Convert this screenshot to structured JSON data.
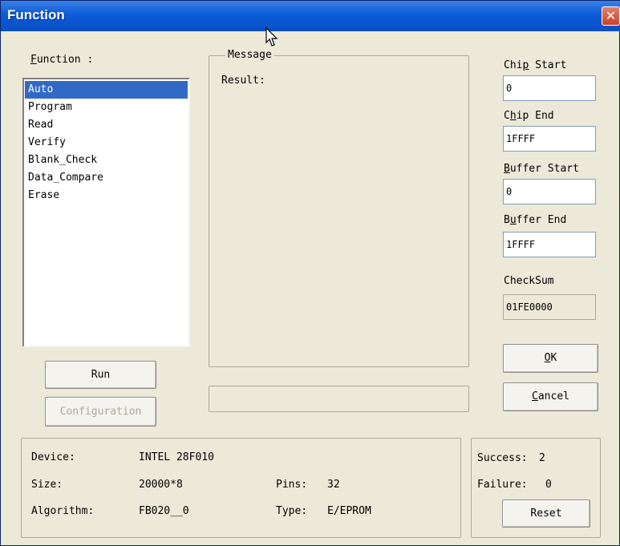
{
  "window": {
    "title": "Function",
    "close_glyph": "✕"
  },
  "function_list": {
    "label": "Function :",
    "items": [
      "Auto",
      "Program",
      "Read",
      "Verify",
      "Blank_Check",
      "Data_Compare",
      "Erase"
    ],
    "selected": "Auto"
  },
  "message": {
    "legend": "Message",
    "result_label": "Result:"
  },
  "fields": {
    "chip_start": {
      "label": "Chip Start",
      "value": "0"
    },
    "chip_end": {
      "label": "Chip End",
      "value": "1FFFF"
    },
    "buffer_start": {
      "label": "Buffer Start",
      "value": "0"
    },
    "buffer_end": {
      "label": "Buffer End",
      "value": "1FFFF"
    },
    "checksum": {
      "label": "CheckSum",
      "value": "01FE0000"
    }
  },
  "buttons": {
    "ok": "OK",
    "cancel": "Cancel",
    "run": "Run",
    "configuration": "Configuration",
    "reset": "Reset"
  },
  "device_info": {
    "device_label": "Device:",
    "device_value": "INTEL 28F010",
    "size_label": "Size:",
    "size_value": "20000*8",
    "algorithm_label": "Algorithm:",
    "algorithm_value": "FB020__0",
    "pins_label": "Pins:",
    "pins_value": "32",
    "type_label": "Type:",
    "type_value": "E/EPROM"
  },
  "stats": {
    "success_label": "Success:",
    "success_value": "2",
    "failure_label": "Failure:",
    "failure_value": "0"
  },
  "colors": {
    "titlebar": "#0a4fc4",
    "selection": "#316ac5",
    "dialog_bg": "#ece9d8"
  }
}
